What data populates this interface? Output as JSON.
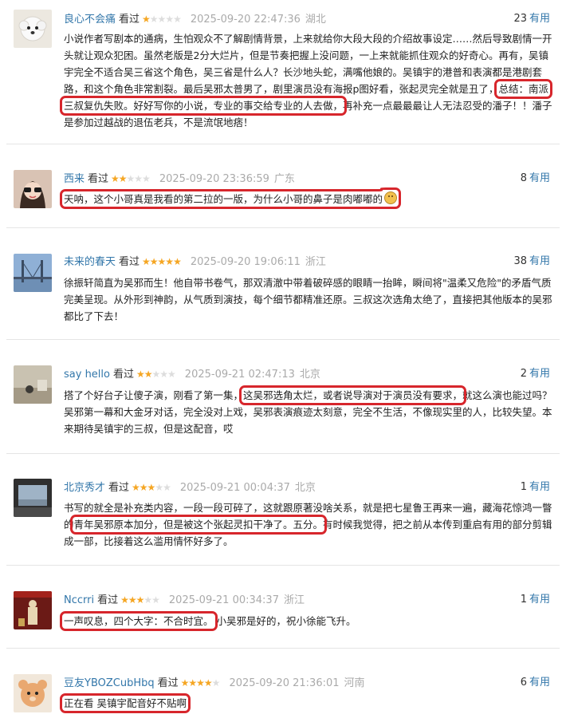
{
  "ui": {
    "watched_label": "看过",
    "useful_label": "有用"
  },
  "reviews": [
    {
      "user": "良心不会痛",
      "stars": 1,
      "time": "2025-09-20 22:47:36",
      "location": "湖北",
      "useful": "23",
      "text_before": "小说作者写剧本的通病，生怕观众不了解剧情背景，上来就给你大段大段的介绍故事设定……然后导致剧情一开头就让观众犯困。虽然老版是2分大烂片，但是节奏把握上没问题，一上来就能抓住观众的好奇心。再有，吴镇宇完全不适合吴三省这个角色，吴三省是什么人？长沙地头蛇，满嘴他娘的。吴镇宇的港普和表演都是港剧套路，和这个角色非常割裂。最后吴邪太普男了，剧里演员没有海报p图好看，张起灵完全就是丑了，",
      "highlight": "总结：南派三叔复仇失败。好好写你的小说，专业的事交给专业的人去做，",
      "text_after": "再补充一点最最最让人无法忍受的潘子！！潘子是参加过越战的退伍老兵，不是流氓地痞！"
    },
    {
      "user": "西来",
      "stars": 2,
      "time": "2025-09-20 23:36:59",
      "location": "广东",
      "useful": "8",
      "text_before": "",
      "highlight": "天呐，这个小哥真是我看的第二拉的一版，为什么小哥的鼻子是肉嘟嘟的",
      "text_after": ""
    },
    {
      "user": "未来的春天",
      "stars": 5,
      "time": "2025-09-20 19:06:11",
      "location": "浙江",
      "useful": "38",
      "text_before": "徐振轩简直为吴邪而生！他自带书卷气，那双清澈中带着破碎感的眼睛一抬眸，瞬间将\"温柔又危险\"的矛盾气质完美呈现。从外形到神韵，从气质到演技，每个细节都精准还原。三叔这次选角太绝了，直接把其他版本的吴邪都比了下去！",
      "highlight": "",
      "text_after": ""
    },
    {
      "user": "say hello",
      "stars": 2,
      "time": "2025-09-21 02:47:13",
      "location": "北京",
      "useful": "2",
      "text_before": "搭了个好台子让傻子演，刚看了第一集，",
      "highlight": "这吴邪选角太烂，或者说导演对于演员没有要求，",
      "text_after": "就这么演也能过吗？吴邪第一幕和大金牙对话，完全没对上戏，吴邪表演痕迹太刻意，完全不生活，不像现实里的人，比较失望。本来期待吴镇宇的三叔，但是这配音，哎"
    },
    {
      "user": "北京秀才",
      "stars": 3,
      "time": "2025-09-21 00:04:37",
      "location": "北京",
      "useful": "1",
      "text_before": "书写的就全是补充类内容，一段一段可碎了，这就跟原著没啥关系，就是把七星鲁王再来一遍，藏海花惊鸿一瞥的",
      "highlight": "青年吴邪原本加分，但是被这个张起灵扣干净了。五分。",
      "text_after": "有时候我觉得，把之前从本传到重启有用的部分剪辑成一部，比接着这么滥用情怀好多了。"
    },
    {
      "user": "Nccrri",
      "stars": 3,
      "time": "2025-09-21 00:34:37",
      "location": "浙江",
      "useful": "1",
      "text_before": "",
      "highlight": "一声叹息，四个大字：不合时宜。",
      "text_after": "小吴邪是好的，祝小徐能飞升。"
    },
    {
      "user": "豆友YBOZCubHbq",
      "stars": 4,
      "time": "2025-09-20 21:36:01",
      "location": "河南",
      "useful": "6",
      "text_before": "",
      "highlight": "正在看 吴镇宇配音好不贴啊",
      "text_after": ""
    }
  ]
}
